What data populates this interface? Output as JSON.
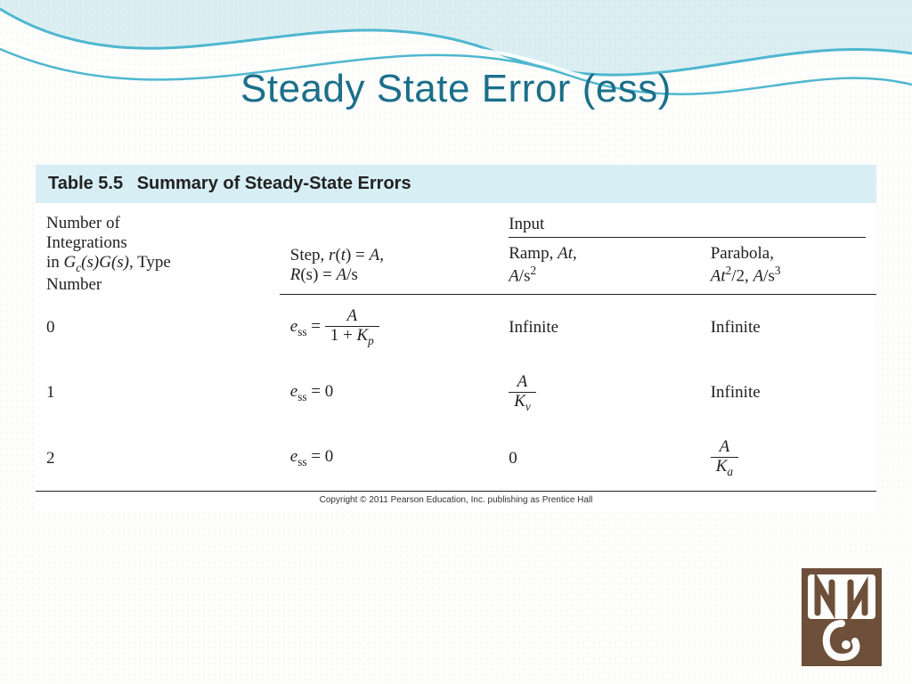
{
  "title": "Steady State Error (ess)",
  "table": {
    "label": "Table 5.5",
    "summary": "Summary of Steady-State Errors",
    "copyright": "Copyright © 2011 Pearson Education, Inc. publishing as Prentice Hall",
    "header": {
      "type_col_l1": "Number of",
      "type_col_l2": "Integrations",
      "type_col_l3a": "in ",
      "type_col_l3_gc": "G",
      "type_col_l3_c": "c",
      "type_col_l3_mid": "(s)G(s),",
      "type_col_l3_end": " Type",
      "type_col_l4": "Number",
      "input_super": "Input",
      "step_l1a": "Step, ",
      "step_l1_r": "r",
      "step_l1_mid": "(",
      "step_l1_t": "t",
      "step_l1_end": ") = ",
      "step_l1_A": "A",
      "step_l1_comma": ",",
      "step_l2_R": "R",
      "step_l2_mid": "(s) = ",
      "step_l2_A": "A",
      "step_l2_end": "/s",
      "ramp_l1a": "Ramp, ",
      "ramp_l1_A": "A",
      "ramp_l1_t": "t",
      "ramp_l1_end": ",",
      "ramp_l2_A": "A",
      "ramp_l2_end": "/s",
      "ramp_l2_sup": "2",
      "para_l1a": "Parabola,",
      "para_l2_A": "A",
      "para_l2_t": "t",
      "para_l2_sup": "2",
      "para_l2_mid": "/2, ",
      "para_l2_A2": "A",
      "para_l2_end": "/s",
      "para_l2_sup2": "3"
    },
    "rows": [
      {
        "type": "0",
        "step_prefix": "e",
        "step_sub": "ss",
        "step_eq": " = ",
        "step_num": "A",
        "step_den_a": "1 + ",
        "step_den_K": "K",
        "step_den_sub": "p",
        "ramp": "Infinite",
        "para": "Infinite"
      },
      {
        "type": "1",
        "step_prefix": "e",
        "step_sub": "ss",
        "step_eq": " = 0",
        "ramp_num": "A",
        "ramp_den_K": "K",
        "ramp_den_sub": "v",
        "para": "Infinite"
      },
      {
        "type": "2",
        "step_prefix": "e",
        "step_sub": "ss",
        "step_eq": " = 0",
        "ramp": "0",
        "para_num": "A",
        "para_den_K": "K",
        "para_den_sub": "a"
      }
    ]
  }
}
